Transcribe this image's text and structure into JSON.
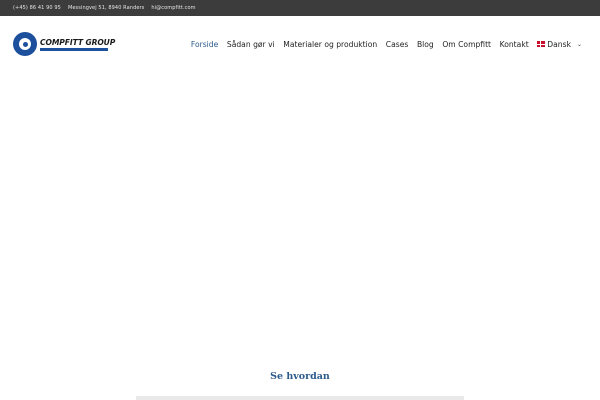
{
  "topbar": {
    "phone": "(+45) 86 41 90 95",
    "address": "Messingvej 51, 8940 Randers",
    "email": "hi@compfitt.com"
  },
  "logo": {
    "text": "COMPFITT GROUP",
    "brand_color": "#1c4f9c"
  },
  "nav": {
    "items": [
      {
        "label": "Forside",
        "active": true
      },
      {
        "label": "Sådan gør vi"
      },
      {
        "label": "Materialer og produktion"
      },
      {
        "label": "Cases"
      },
      {
        "label": "Blog"
      },
      {
        "label": "Om Compfitt"
      },
      {
        "label": "Kontakt"
      }
    ],
    "language": {
      "label": "Dansk",
      "flag_icon": "denmark-flag-icon",
      "chevron_icon": "chevron-down-icon"
    },
    "active_color": "#2b5a8c"
  },
  "section": {
    "title": "Se hvordan"
  }
}
